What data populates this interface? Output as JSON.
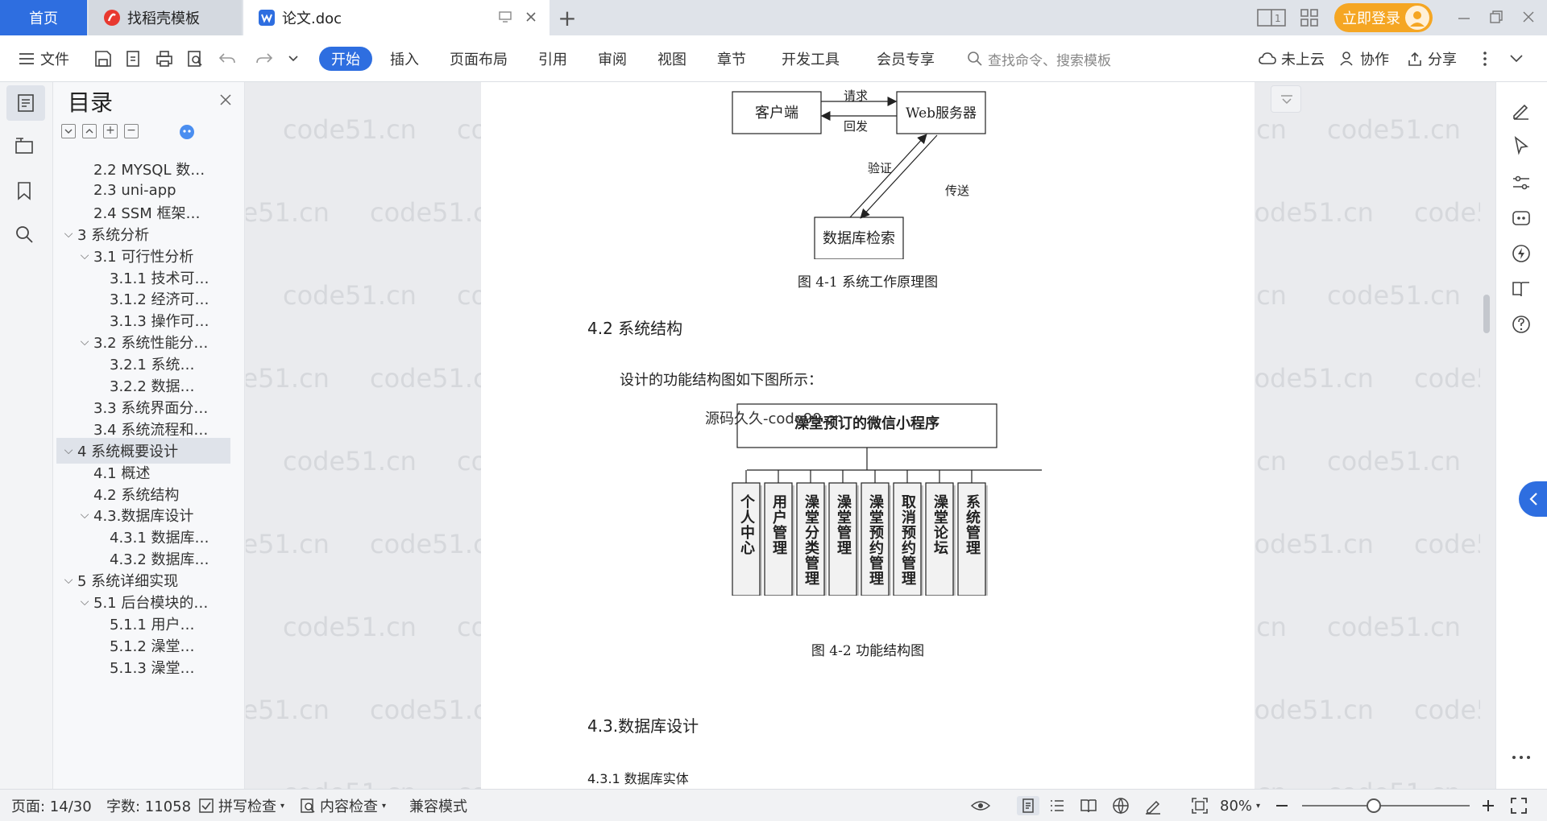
{
  "tabs": {
    "home": "首页",
    "daoke": "找稻壳模板",
    "doc": "论文.doc"
  },
  "topbar": {
    "login": "立即登录"
  },
  "toolbar": {
    "file": "文件",
    "start": "开始",
    "insert": "插入",
    "layout": "页面布局",
    "reference": "引用",
    "review": "审阅",
    "view": "视图",
    "chapter": "章节",
    "devtools": "开发工具",
    "member": "会员专享",
    "search_placeholder": "查找命令、搜索模板",
    "cloud": "未上云",
    "collab": "协作",
    "share": "分享"
  },
  "toc": {
    "title": "目录",
    "items": [
      {
        "label": "2.2 MYSQL 数…",
        "level": 2,
        "chevron": false
      },
      {
        "label": "2.3 uni-app",
        "level": 2,
        "chevron": false
      },
      {
        "label": "2.4 SSM 框架…",
        "level": 2,
        "chevron": false
      },
      {
        "label": "3 系统分析",
        "level": 1,
        "chevron": true
      },
      {
        "label": "3.1 可行性分析",
        "level": 2,
        "chevron": true
      },
      {
        "label": "3.1.1 技术可…",
        "level": 3,
        "chevron": false
      },
      {
        "label": "3.1.2 经济可…",
        "level": 3,
        "chevron": false
      },
      {
        "label": "3.1.3 操作可…",
        "level": 3,
        "chevron": false
      },
      {
        "label": "3.2 系统性能分…",
        "level": 2,
        "chevron": true
      },
      {
        "label": "3.2.1  系统…",
        "level": 3,
        "chevron": false
      },
      {
        "label": "3.2.2  数据…",
        "level": 3,
        "chevron": false
      },
      {
        "label": "3.3 系统界面分…",
        "level": 2,
        "chevron": false
      },
      {
        "label": "3.4 系统流程和…",
        "level": 2,
        "chevron": false
      },
      {
        "label": "4 系统概要设计",
        "level": 1,
        "chevron": true,
        "active": true
      },
      {
        "label": "4.1 概述",
        "level": 2,
        "chevron": false
      },
      {
        "label": "4.2 系统结构",
        "level": 2,
        "chevron": false
      },
      {
        "label": "4.3.数据库设计",
        "level": 2,
        "chevron": true
      },
      {
        "label": "4.3.1 数据库…",
        "level": 3,
        "chevron": false
      },
      {
        "label": "4.3.2 数据库…",
        "level": 3,
        "chevron": false
      },
      {
        "label": "5 系统详细实现",
        "level": 1,
        "chevron": true
      },
      {
        "label": "5.1  后台模块的…",
        "level": 2,
        "chevron": true
      },
      {
        "label": "5.1.1  用户…",
        "level": 3,
        "chevron": false
      },
      {
        "label": "5.1.2  澡堂…",
        "level": 3,
        "chevron": false
      },
      {
        "label": "5.1.3  澡堂…",
        "level": 3,
        "chevron": false
      }
    ]
  },
  "watermark": "code51.cn",
  "document": {
    "fig1": {
      "client": "客户端",
      "server": "Web服务器",
      "db": "数据库检索",
      "request": "请求",
      "reply": "回发",
      "verify": "验证",
      "transfer": "传送",
      "caption": "图 4-1 系统工作原理图"
    },
    "heading_42": "4.2 系统结构",
    "para_42": "设计的功能结构图如下图所示：",
    "fig2": {
      "overlay": "源码久久-code99.cn",
      "root": "澡堂预订的微信小程序",
      "modules": [
        "个人中心",
        "用户管理",
        "澡堂分类管理",
        "澡堂管理",
        "澡堂预约管理",
        "取消预约管理",
        "澡堂论坛",
        "系统管理"
      ],
      "caption": "图 4-2 功能结构图"
    },
    "heading_43": "4.3.数据库设计",
    "heading_431": "4.3.1 数据库实体"
  },
  "status": {
    "page": "页面: 14/30",
    "words": "字数: 11058",
    "spell": "拼写检查",
    "content": "内容检查",
    "compat": "兼容模式",
    "zoom": "80%"
  },
  "colors": {
    "accent": "#2e6ee0",
    "login": "#f5a623"
  }
}
